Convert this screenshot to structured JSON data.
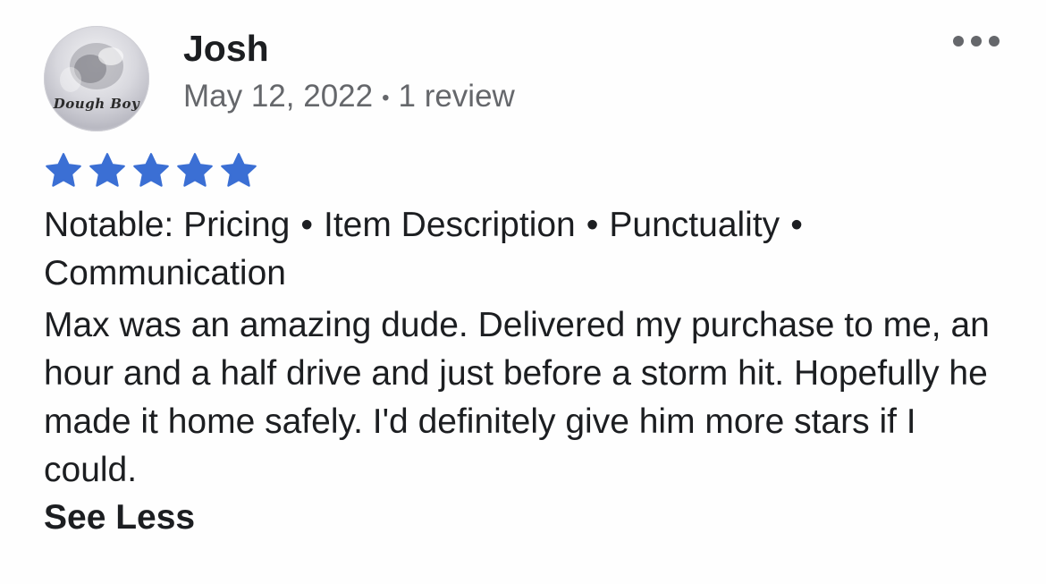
{
  "review": {
    "reviewer_name": "Josh",
    "avatar_text": "Dough Boy",
    "date": "May 12, 2022",
    "separator": "•",
    "review_count": "1 review",
    "rating": 5,
    "rating_max": 5,
    "star_color": "#3b6fd4",
    "notable_prefix": "Notable: ",
    "notable_tags": [
      "Pricing",
      "Item Description",
      "Punctuality",
      "Communication"
    ],
    "body": "Max was an amazing dude. Delivered my purchase to me, an hour and a half drive and just before a storm hit. Hopefully he made it home safely. I'd definitely give him more stars if I could.",
    "toggle_label": "See Less",
    "more_icon": "more-horizontal-icon"
  }
}
